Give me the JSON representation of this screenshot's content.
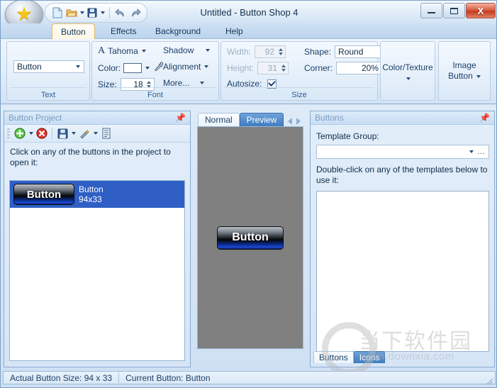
{
  "window": {
    "title": "Untitled - Button Shop 4",
    "orb_icon": "star-icon",
    "quick_access": [
      {
        "name": "new-document-icon",
        "label": "New",
        "has_caret": false
      },
      {
        "name": "open-folder-icon",
        "label": "Open",
        "has_caret": true
      },
      {
        "name": "save-disk-icon",
        "label": "Save",
        "has_caret": true
      },
      {
        "name": "undo-icon",
        "label": "Undo",
        "has_caret": false
      },
      {
        "name": "redo-icon",
        "label": "Redo",
        "has_caret": false
      }
    ],
    "controls": {
      "minimize": "–",
      "maximize": "□",
      "close": "X"
    }
  },
  "ribbon": {
    "tabs": [
      {
        "label": "Button",
        "active": true
      },
      {
        "label": "Effects",
        "active": false
      },
      {
        "label": "Background",
        "active": false
      },
      {
        "label": "Help",
        "active": false
      }
    ],
    "groups": {
      "text": {
        "caption": "Text",
        "button_text_value": "Button"
      },
      "font": {
        "caption": "Font",
        "font_family_icon": "font-letter-a-icon",
        "font_family_value": "Tahoma",
        "color_label": "Color:",
        "color_value": "#ffffff",
        "eyedropper_icon": "eyedropper-icon",
        "size_label": "Size:",
        "size_value": "18",
        "shadow_label": "Shadow",
        "alignment_label": "Alignment",
        "more_label": "More..."
      },
      "size": {
        "caption": "Size",
        "width_label": "Width:",
        "width_value": "92",
        "height_label": "Height:",
        "height_value": "31",
        "autosize_label": "Autosize:",
        "autosize_checked": true,
        "shape_label": "Shape:",
        "shape_value": "Round",
        "corner_label": "Corner:",
        "corner_value": "20%"
      },
      "color_texture": {
        "line1": "Color/Texture",
        "line2": ""
      },
      "image_button": {
        "line1": "Image",
        "line2": "Button"
      }
    }
  },
  "left_panel": {
    "title": "Button Project",
    "pin_icon": "pin-icon",
    "toolbar": [
      {
        "name": "add-button-icon",
        "has_caret": true
      },
      {
        "name": "delete-button-icon",
        "has_caret": false
      },
      {
        "name": "save-icon",
        "has_caret": true
      },
      {
        "name": "wand-icon",
        "has_caret": true
      },
      {
        "name": "list-icon",
        "has_caret": false
      }
    ],
    "hint": "Click on any of the buttons in the project to open it:",
    "items": [
      {
        "preview_label": "Button",
        "name": "Button",
        "size": "94x33",
        "selected": true
      }
    ]
  },
  "center_panel": {
    "tabs": [
      {
        "label": "Normal",
        "active": false
      },
      {
        "label": "Preview",
        "active": true
      }
    ],
    "nav_prev_icon": "chevron-left-icon",
    "nav_next_icon": "chevron-right-icon",
    "canvas_color": "#808080",
    "preview_button_label": "Button"
  },
  "right_panel": {
    "title": "Buttons",
    "pin_icon": "pin-icon",
    "template_group_label": "Template Group:",
    "template_group_value": "",
    "template_group_more": "…",
    "hint": "Double-click on any of the templates below to use it:",
    "bottom_tabs": [
      {
        "label": "Buttons",
        "active": false
      },
      {
        "label": "Icons",
        "active": true
      }
    ]
  },
  "status_bar": {
    "actual_size_label": "Actual Button Size:",
    "actual_size_value": "94 x 33",
    "current_button_label": "Current Button:",
    "current_button_value": "Button"
  },
  "watermark": {
    "cn_text": "当下软件园",
    "url_text": "www.downxia.com"
  }
}
